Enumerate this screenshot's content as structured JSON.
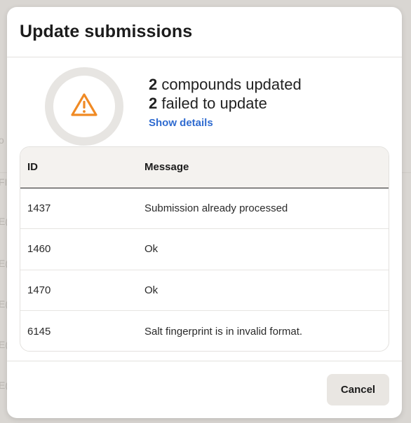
{
  "background": {
    "fragments": [
      "o",
      "FI",
      "E(",
      "E(",
      "E(",
      "E(",
      "E("
    ]
  },
  "modal": {
    "title": "Update submissions",
    "summary": {
      "updated_count": "2",
      "updated_text": " compounds updated",
      "failed_count": "2",
      "failed_text": " failed to update",
      "details_link": "Show details",
      "status_icon": "warning-triangle-icon",
      "icon_color": "#f08a24"
    },
    "table": {
      "headers": [
        "ID",
        "Message"
      ],
      "rows": [
        {
          "id": "1437",
          "message": "Submission already processed"
        },
        {
          "id": "1460",
          "message": "Ok"
        },
        {
          "id": "1470",
          "message": "Ok"
        },
        {
          "id": "6145",
          "message": "Salt fingerprint is in invalid format."
        }
      ]
    },
    "footer": {
      "cancel_label": "Cancel"
    }
  },
  "colors": {
    "link": "#2f6bd0",
    "warning": "#f08a24"
  }
}
